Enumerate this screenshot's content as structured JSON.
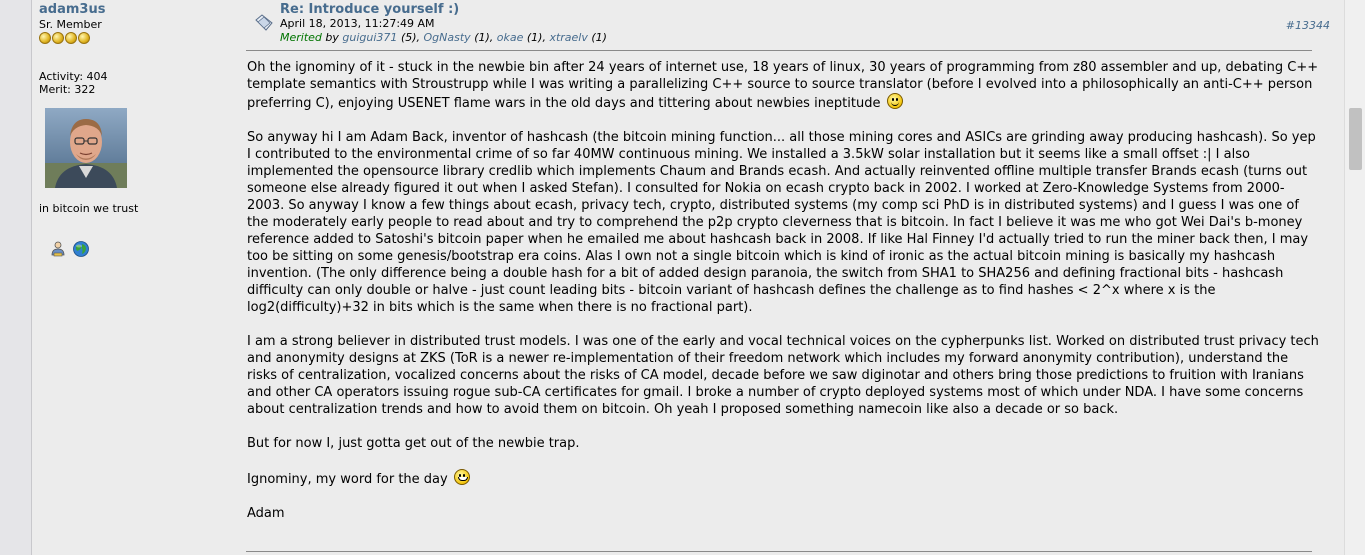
{
  "poster": {
    "name": "adam3us",
    "rank": "Sr. Member",
    "stars": 4,
    "activity": "Activity: 404",
    "merit": "Merit: 322",
    "personal_text": "in bitcoin we trust"
  },
  "post": {
    "subject": "Re: Introduce yourself :)",
    "date": "April 18, 2013, 11:27:49 AM",
    "merited_label": "Merited",
    "merited_by": "by",
    "meriters": [
      {
        "name": "guigui371",
        "count": "(5),"
      },
      {
        "name": "OgNasty",
        "count": "(1),"
      },
      {
        "name": "okae",
        "count": "(1),"
      },
      {
        "name": "xtraelv",
        "count": "(1)"
      }
    ],
    "number": "#13344",
    "paragraphs": [
      "Oh the ignominy of it - stuck in the newbie bin after 24 years of internet use, 18 years of linux, 30 years of programming from z80 assembler and up,  debating C++ template semantics with Stroustrupp while I was writing a parallelizing C++ source to source translator (before I evolved into a philosophically an anti-C++ person preferring C), enjoying USENET flame wars in the old days and tittering about newbies ineptitude",
      "So anyway hi I am Adam Back, inventor of hashcash (the bitcoin mining function... all those mining cores and ASICs are grinding away producing hashcash).  So yep I contributed to the environmental crime of so far 40MW continuous mining.  We installed a 3.5kW solar installation but it seems like a small offset :|  I also implemented the opensource library credlib which implements Chaum and Brands ecash.  And actually reinvented offline multiple transfer Brands ecash (turns out someone else already figured it out when I asked Stefan).  I consulted for Nokia on ecash crypto back in 2002.  I worked at Zero-Knowledge Systems from 2000-2003.  So anyway I know a few things about ecash, privacy tech, crypto, distributed systems (my comp sci PhD is in distributed systems) and I guess I was one of the moderately early people to read about and try to comprehend the p2p crypto cleverness that is bitcoin.  In fact I believe it was me who got Wei Dai's b-money reference added to Satoshi's bitcoin paper when he emailed me about hashcash back in 2008.  If like Hal Finney I'd actually tried to run the miner back then, I may too be sitting on some genesis/bootstrap era coins.  Alas I own not a single bitcoin which is kind of ironic as the actual bitcoin mining is basically my hashcash invention.  (The only difference being a double hash for a bit of added design paranoia, the switch from SHA1 to SHA256 and defining fractional bits - hashcash difficulty can only double or halve - just count leading bits - bitcoin variant of hashcash defines the challenge as to find hashes < 2^x where x is the log2(difficulty)+32 in bits which is the same when there is no fractional part).",
      "I am a strong believer in distributed trust models.  I was one of the early and vocal technical voices on the cypherpunks list.  Worked on distributed trust privacy tech and anonymity designs at ZKS (ToR is a newer re-implementation of their freedom network which includes my forward anonymity contribution), understand the risks of centralization, vocalized concerns about the risks of CA model, decade before we saw diginotar and others bring those predictions to fruition with Iranians and other CA operators issuing rogue sub-CA certificates for gmail.  I broke a number of crypto deployed systems most of which under NDA.  I have some concerns about centralization trends and how to avoid them on bitcoin.  Oh yeah I proposed something namecoin like also a decade or so back.",
      "But for now I, just gotta get out of the newbie trap.",
      "Ignominy, my word for the day",
      "Adam"
    ]
  },
  "icons": {
    "post_icon": "post-xx-icon",
    "profile": "profile-icon",
    "website": "globe-icon",
    "smiley": "smiley-icon",
    "grin": "grin-icon"
  }
}
